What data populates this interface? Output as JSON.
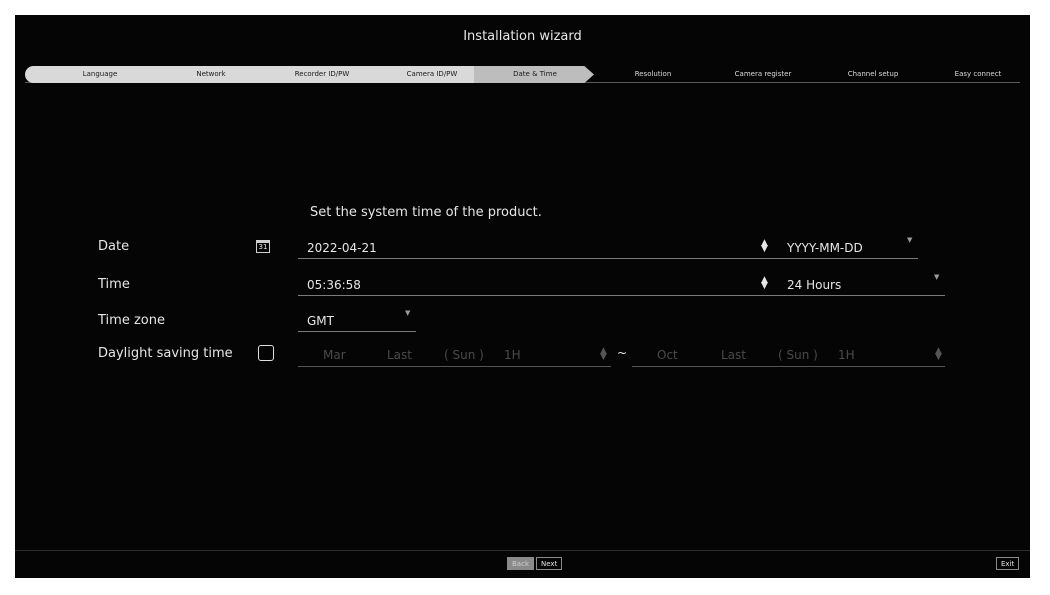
{
  "window": {
    "title": "Installation wizard"
  },
  "steps": [
    {
      "label": "Language",
      "state": "done"
    },
    {
      "label": "Network",
      "state": "done"
    },
    {
      "label": "Recorder ID/PW",
      "state": "done"
    },
    {
      "label": "Camera ID/PW",
      "state": "done"
    },
    {
      "label": "Date & Time",
      "state": "active"
    },
    {
      "label": "Resolution",
      "state": "pending"
    },
    {
      "label": "Camera register",
      "state": "pending"
    },
    {
      "label": "Channel setup",
      "state": "pending"
    },
    {
      "label": "Easy connect",
      "state": "pending"
    }
  ],
  "form": {
    "instruction": "Set the system time of the product.",
    "date": {
      "label": "Date",
      "value": "2022-04-21",
      "format": "YYYY-MM-DD",
      "calendar_icon_text": "31"
    },
    "time": {
      "label": "Time",
      "value": "05:36:58",
      "format": "24 Hours"
    },
    "timezone": {
      "label": "Time zone",
      "value": "GMT"
    },
    "dst": {
      "label": "Daylight saving time",
      "checked": false,
      "start": {
        "month": "Mar",
        "week": "Last",
        "day": "( Sun )",
        "hour": "1H"
      },
      "separator": "~",
      "end": {
        "month": "Oct",
        "week": "Last",
        "day": "( Sun )",
        "hour": "1H"
      }
    }
  },
  "footer": {
    "back_label": "Back",
    "next_label": "Next",
    "exit_label": "Exit"
  },
  "colors": {
    "background": "#050505",
    "text": "#e6e6e6",
    "step_done": "#d9d9d9",
    "step_active": "#bdbdbd",
    "disabled": "#555555"
  }
}
